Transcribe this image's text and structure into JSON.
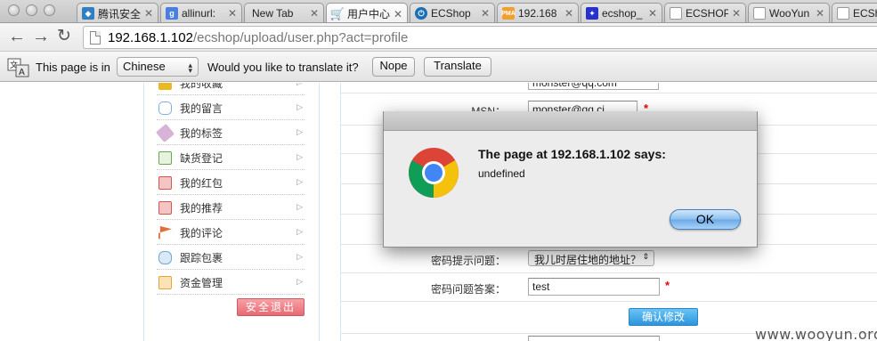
{
  "browser": {
    "tabs": [
      {
        "title": "腾讯安全",
        "icon": "shield-icon",
        "color": "#2f7fc1"
      },
      {
        "title": "allinurl:",
        "icon": "google-icon",
        "color": "#4a7fe0"
      },
      {
        "title": "New Tab",
        "icon": "",
        "color": ""
      },
      {
        "title": "用户中心",
        "icon": "cart-icon",
        "color": "#e88a1a"
      },
      {
        "title": "ECShop",
        "icon": "power-icon",
        "color": "#1b6fb5"
      },
      {
        "title": "192.168",
        "icon": "pma-icon",
        "color": "#f0a030"
      },
      {
        "title": "ecshop_",
        "icon": "paw-icon",
        "color": "#2932c8"
      },
      {
        "title": "ECSHOP",
        "icon": "page-icon",
        "color": ""
      },
      {
        "title": "WooYun",
        "icon": "page-icon",
        "color": ""
      },
      {
        "title": "ECSh",
        "icon": "page-icon",
        "color": ""
      }
    ],
    "url_host": "192.168.1.102",
    "url_path": "/ecshop/upload/user.php?act=profile",
    "translate_bar": {
      "prefix": "This page is in",
      "language": "Chinese",
      "question": "Would you like to translate it?",
      "nope": "Nope",
      "translate": "Translate"
    }
  },
  "sidebar": {
    "items": [
      {
        "label": "我的收藏",
        "icon": "star-icon",
        "color": "#e8b923"
      },
      {
        "label": "我的留言",
        "icon": "speech-bubble-icon",
        "color": "#7fb0e0"
      },
      {
        "label": "我的标签",
        "icon": "tag-icon",
        "color": "#b57ab5"
      },
      {
        "label": "缺货登记",
        "icon": "document-icon",
        "color": "#6aa84f"
      },
      {
        "label": "我的红包",
        "icon": "red-packet-icon",
        "color": "#d9534f"
      },
      {
        "label": "我的推荐",
        "icon": "recommend-icon",
        "color": "#d9534f"
      },
      {
        "label": "我的评论",
        "icon": "flag-icon",
        "color": "#e0703a"
      },
      {
        "label": "跟踪包裹",
        "icon": "package-icon",
        "color": "#6fa8dc"
      },
      {
        "label": "资金管理",
        "icon": "wallet-icon",
        "color": "#e6a23c"
      }
    ],
    "logout": "安全退出"
  },
  "form": {
    "email_value": "monster@qq.com",
    "msn_label": "MSN：",
    "msn_value": "monster@qq.ci",
    "question_label": "密码提示问题：",
    "question_value": "我儿时居住地的地址？",
    "answer_label": "密码问题答案：",
    "answer_value": "test",
    "required_mark": "*",
    "confirm": "确认修改"
  },
  "dialog": {
    "title": "The page at 192.168.1.102 says:",
    "message": "undefined",
    "ok": "OK"
  },
  "watermark": "www.wooyun.org"
}
